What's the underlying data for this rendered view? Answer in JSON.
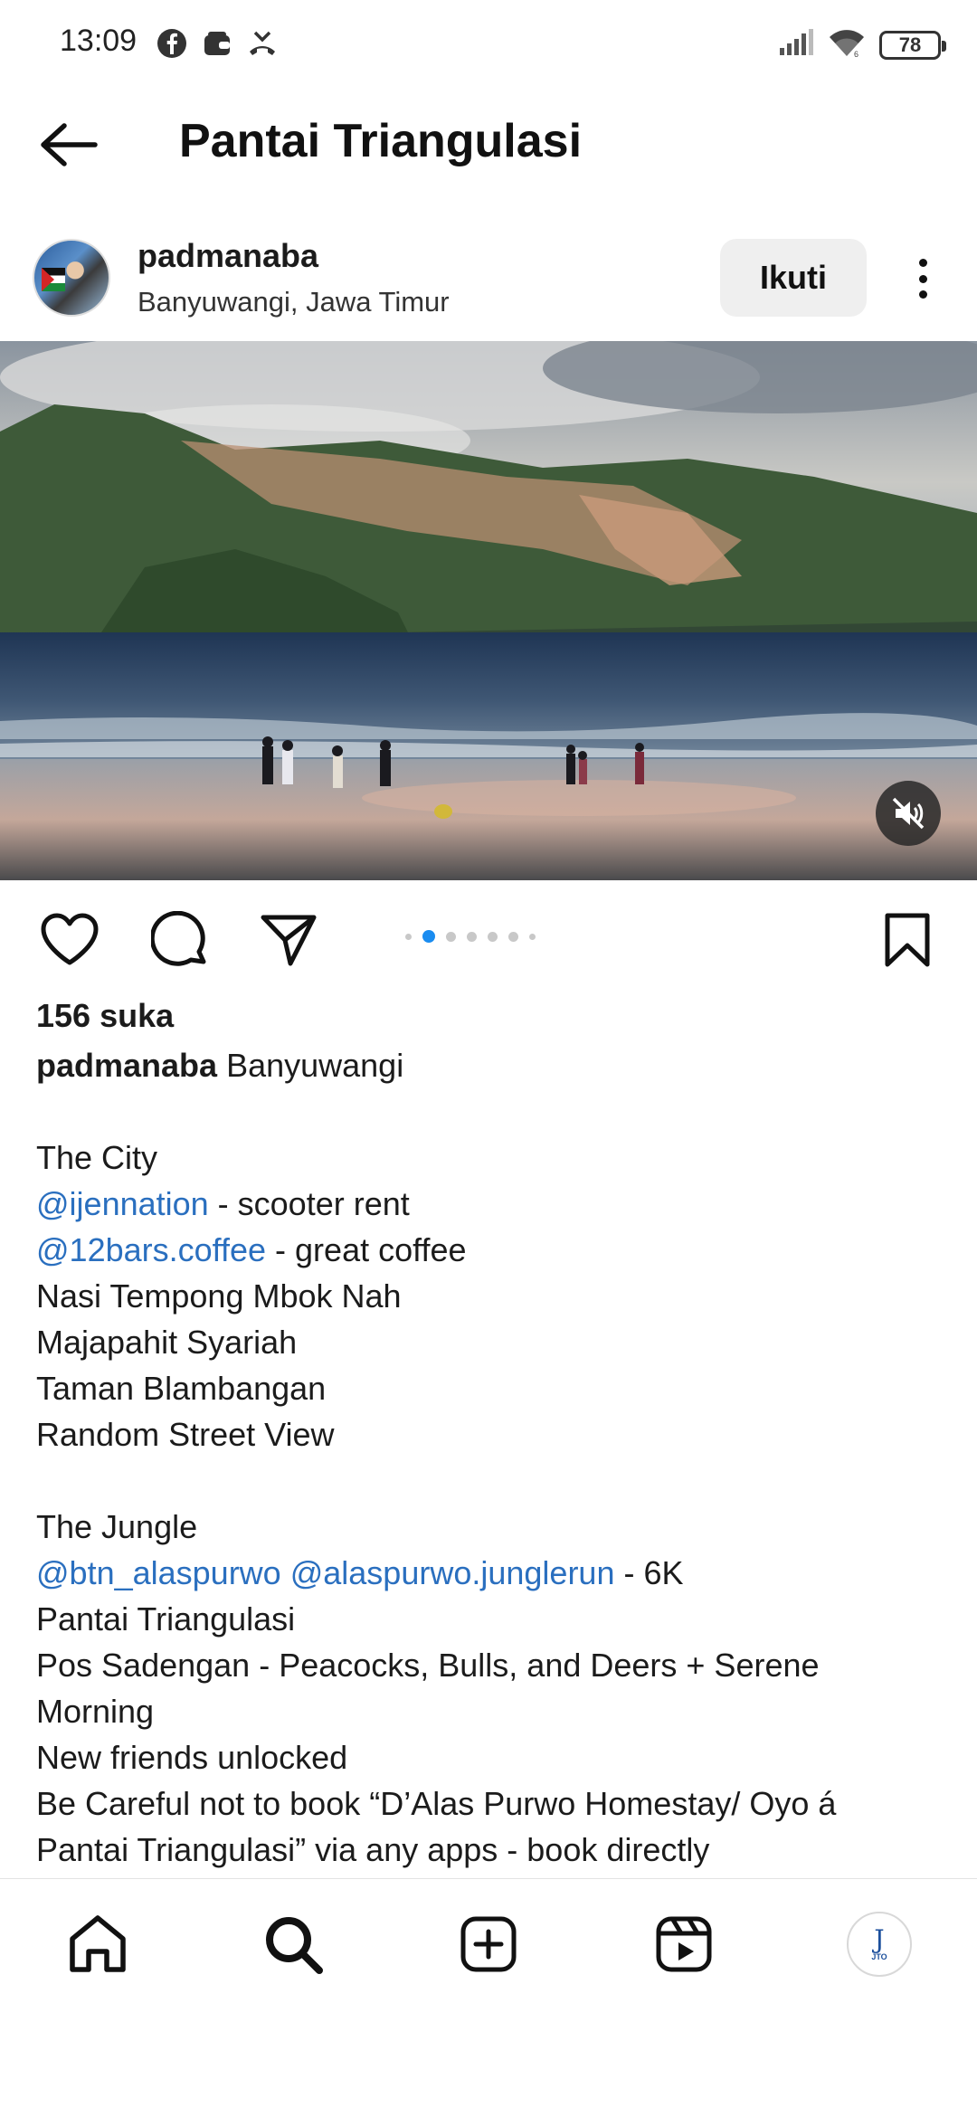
{
  "status_bar": {
    "time": "13:09",
    "battery": "78",
    "icons_left": [
      "facebook-icon",
      "wallet-icon",
      "missed-call-icon"
    ],
    "icons_right": [
      "signal-icon",
      "wifi-icon",
      "battery-icon"
    ]
  },
  "header": {
    "title": "Pantai Triangulasi",
    "back_icon": "arrow-left-icon"
  },
  "post": {
    "username": "padmanaba",
    "location": "Banyuwangi, Jawa Timur",
    "follow_label": "Ikuti",
    "carousel": {
      "total": 7,
      "active_index": 1
    },
    "likes": "156 suka"
  },
  "caption": {
    "author": "padmanaba",
    "first_line_text": " Banyuwangi",
    "lines": [
      {
        "parts": []
      },
      {
        "parts": [
          {
            "text": "The City",
            "type": "text"
          }
        ]
      },
      {
        "parts": [
          {
            "text": "@ijennation",
            "type": "mention"
          },
          {
            "text": " - scooter rent",
            "type": "text"
          }
        ]
      },
      {
        "parts": [
          {
            "text": "@12bars.coffee",
            "type": "mention"
          },
          {
            "text": " - great coffee",
            "type": "text"
          }
        ]
      },
      {
        "parts": [
          {
            "text": "Nasi Tempong Mbok Nah",
            "type": "text"
          }
        ]
      },
      {
        "parts": [
          {
            "text": "Majapahit Syariah",
            "type": "text"
          }
        ]
      },
      {
        "parts": [
          {
            "text": "Taman Blambangan",
            "type": "text"
          }
        ]
      },
      {
        "parts": [
          {
            "text": "Random Street View",
            "type": "text"
          }
        ]
      },
      {
        "parts": []
      },
      {
        "parts": [
          {
            "text": "The Jungle",
            "type": "text"
          }
        ]
      },
      {
        "parts": [
          {
            "text": "@btn_alaspurwo",
            "type": "mention"
          },
          {
            "text": " ",
            "type": "text"
          },
          {
            "text": "@alaspurwo.junglerun",
            "type": "mention"
          },
          {
            "text": " - 6K",
            "type": "text"
          }
        ]
      },
      {
        "parts": [
          {
            "text": "Pantai Triangulasi",
            "type": "text"
          }
        ]
      },
      {
        "parts": [
          {
            "text": "Pos Sadengan - Peacocks, Bulls, and Deers + Serene",
            "type": "text"
          }
        ]
      },
      {
        "parts": [
          {
            "text": "Morning",
            "type": "text"
          }
        ]
      },
      {
        "parts": [
          {
            "text": "New friends unlocked",
            "type": "text"
          }
        ]
      },
      {
        "parts": [
          {
            "text": "Be Careful not to book “D’Alas Purwo Homestay/ Oyo á",
            "type": "text"
          }
        ]
      },
      {
        "parts": [
          {
            "text": "Pantai Triangulasi” via any apps - book directly",
            "type": "text"
          }
        ]
      }
    ]
  },
  "nav": {
    "items": [
      "home-icon",
      "search-icon",
      "create-icon",
      "reels-icon",
      "profile-avatar"
    ],
    "profile_logo_letter": "J",
    "profile_logo_text": "JTO"
  },
  "colors": {
    "mention": "#2a6fbf",
    "carousel_active": "#1a8cf0",
    "follow_bg": "#efefef"
  }
}
